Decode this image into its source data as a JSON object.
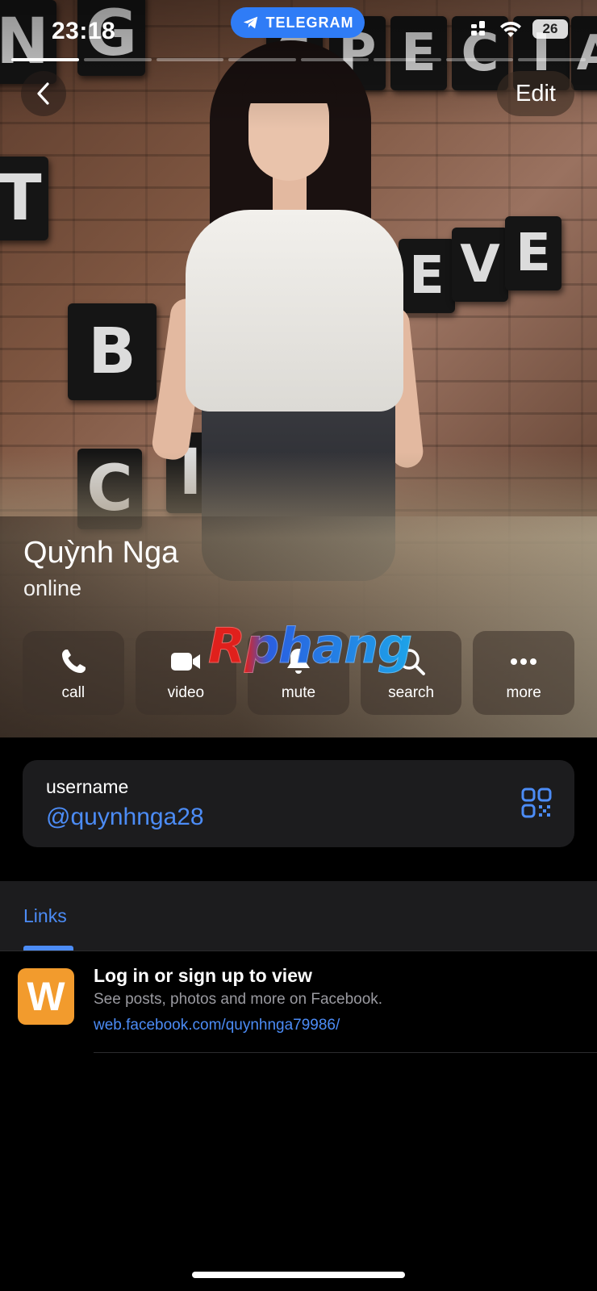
{
  "status_bar": {
    "time": "23:18",
    "app_pill_label": "TELEGRAM",
    "battery": "26"
  },
  "header": {
    "edit_label": "Edit",
    "sign_letters": [
      "N",
      "G",
      "S",
      "P",
      "E",
      "C",
      "I",
      "A",
      "T",
      "B",
      "E",
      "V",
      "E",
      "C",
      "I"
    ]
  },
  "profile": {
    "name": "Quỳnh Nga",
    "status": "online"
  },
  "actions": [
    {
      "label": "call",
      "icon": "phone-icon"
    },
    {
      "label": "video",
      "icon": "video-camera-icon"
    },
    {
      "label": "mute",
      "icon": "bell-icon"
    },
    {
      "label": "search",
      "icon": "search-icon"
    },
    {
      "label": "more",
      "icon": "ellipsis-icon"
    }
  ],
  "watermark": "Rphang",
  "username_card": {
    "label": "username",
    "value": "@quynhnga28"
  },
  "links": {
    "tab_label": "Links",
    "items": [
      {
        "thumb_letter": "W",
        "title": "Log in or sign up to view",
        "description": "See posts, photos and more on Facebook.",
        "url": "web.facebook.com/quynhnga79986/"
      }
    ]
  },
  "colors": {
    "accent": "#4c8cf6",
    "telegram_pill": "#2f7cf6",
    "card_bg": "#1c1c1e",
    "thumb_bg": "#f29b2d"
  }
}
